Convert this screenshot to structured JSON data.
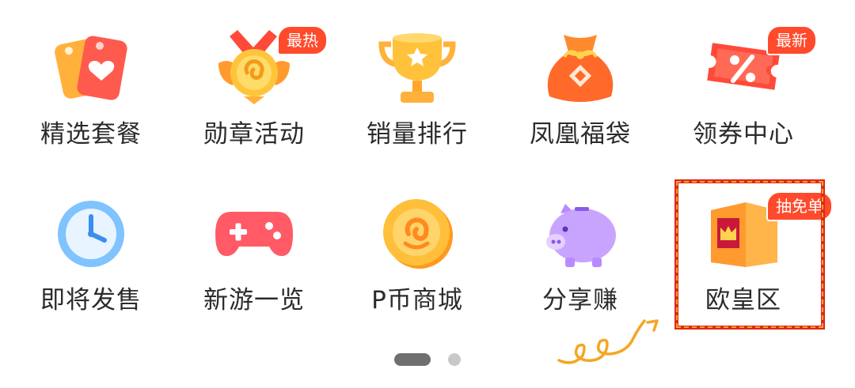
{
  "grid": {
    "items": [
      {
        "label": "精选套餐",
        "icon": "price-tag-heart-icon"
      },
      {
        "label": "勋章活动",
        "icon": "medal-badge-icon",
        "badge": "最热"
      },
      {
        "label": "销量排行",
        "icon": "trophy-icon"
      },
      {
        "label": "凤凰福袋",
        "icon": "lucky-bag-icon"
      },
      {
        "label": "领券中心",
        "icon": "coupon-percent-icon",
        "badge": "最新"
      },
      {
        "label": "即将发售",
        "icon": "clock-icon"
      },
      {
        "label": "新游一览",
        "icon": "gamepad-icon"
      },
      {
        "label": "P币商城",
        "icon": "p-coin-icon"
      },
      {
        "label": "分享赚",
        "icon": "piggy-bank-icon"
      },
      {
        "label": "欧皇区",
        "icon": "crown-box-icon",
        "badge": "抽免单"
      }
    ]
  },
  "pager": {
    "pages": 2,
    "current": 1
  },
  "colors": {
    "badge": "#ff4a2c",
    "highlight_border": "#e2271b",
    "annotation_squiggle": "#f5a623",
    "label_text": "#2b2b2b"
  }
}
